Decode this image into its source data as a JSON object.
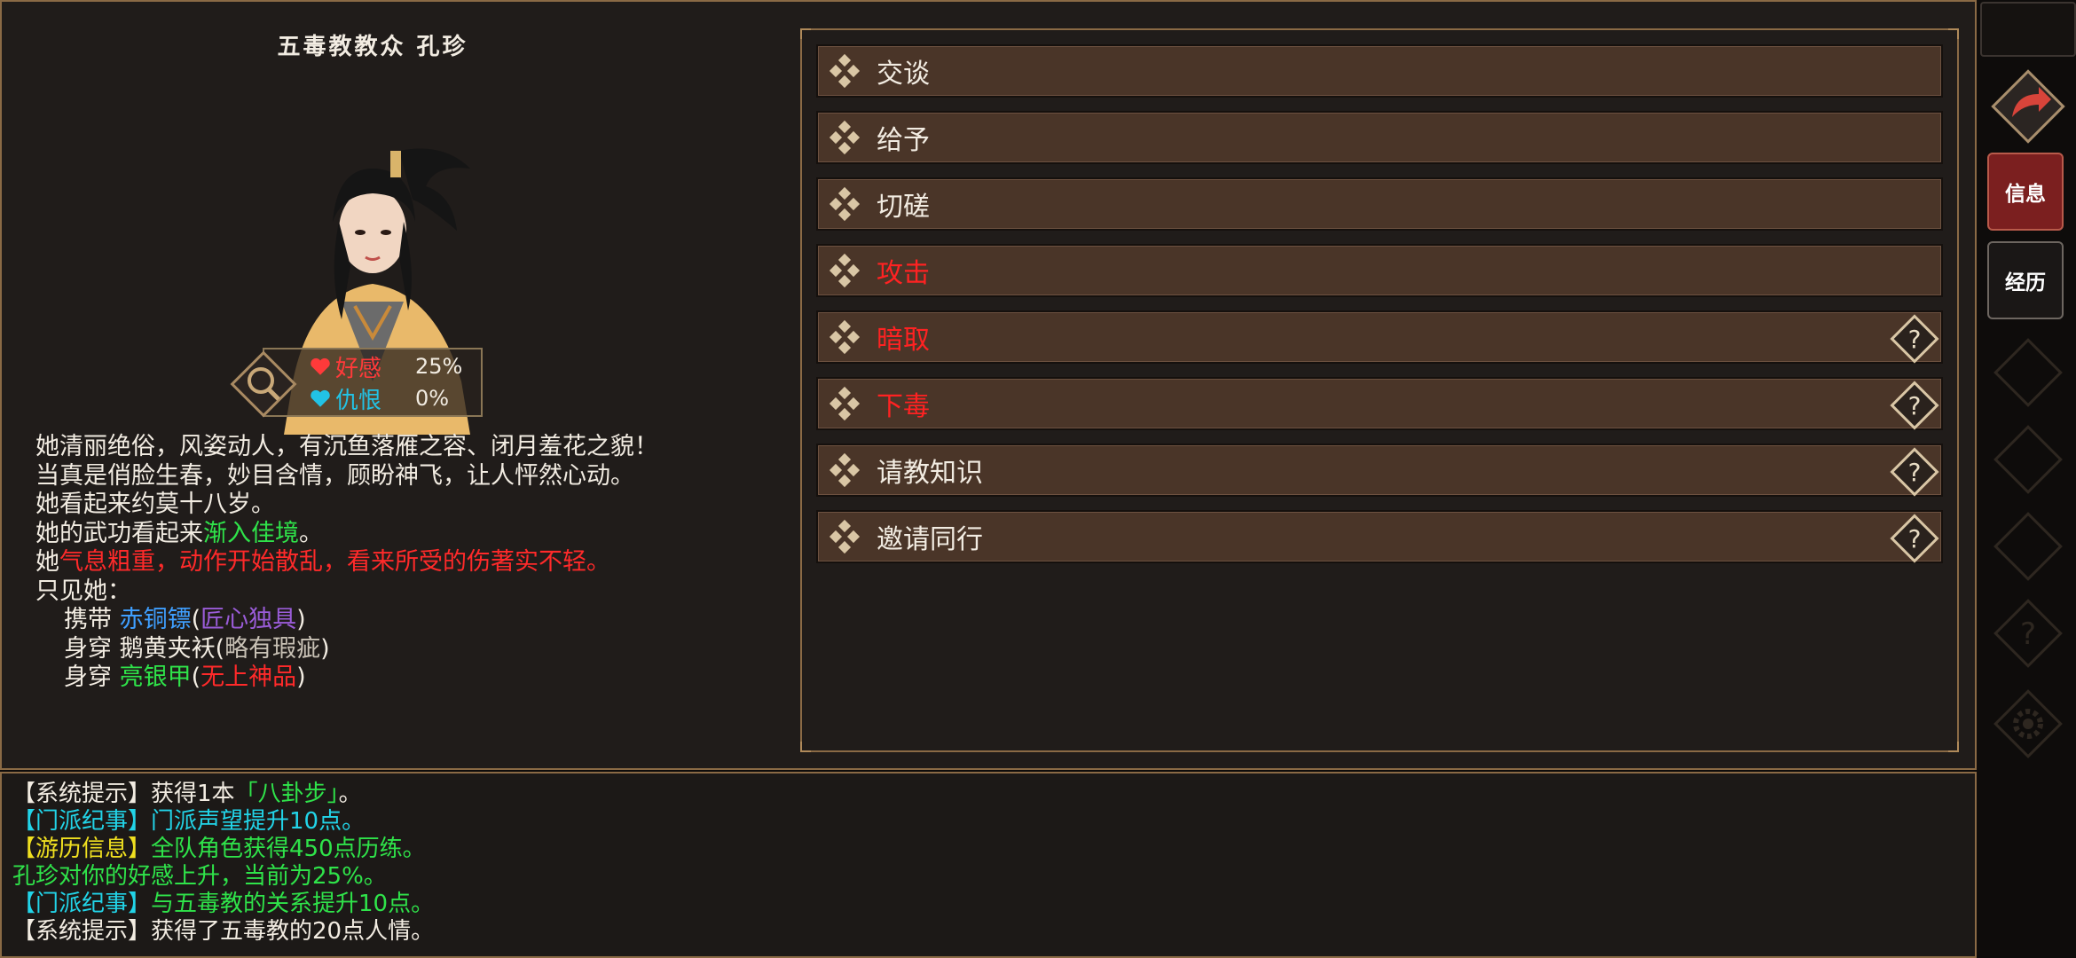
{
  "npc": {
    "title": "五毒教教众  孔珍",
    "favor_label": "好感",
    "favor_value": "25%",
    "hate_label": "仇恨",
    "hate_value": "0%"
  },
  "description": {
    "line1": "她清丽绝俗，风姿动人，有沉鱼落雁之容、闭月羞花之貌！",
    "line2": "当真是俏脸生春，妙目含情，顾盼神飞，让人怦然心动。",
    "line3": "她看起来约莫十八岁。",
    "line4_prefix": "她的武功看起来",
    "line4_level": "渐入佳境",
    "line4_suffix": "。",
    "line5_prefix": "她",
    "line5_status": "气息粗重，动作开始散乱，看来所受的伤著实不轻。",
    "line6": "只见她：",
    "items": [
      {
        "verb": "携带",
        "name": "赤铜镖",
        "open": "(",
        "quality": "匠心独具",
        "close": ")"
      },
      {
        "verb": "身穿",
        "name": "鹅黄夹袄",
        "open": "(",
        "quality": "略有瑕疵",
        "close": ")"
      },
      {
        "verb": "身穿",
        "name": "亮银甲",
        "open": "(",
        "quality": "无上神品",
        "close": ")"
      }
    ]
  },
  "actions": [
    {
      "label": "交谈",
      "color": "#f2ece2"
    },
    {
      "label": "给予",
      "color": "#f2ece2"
    },
    {
      "label": "切磋",
      "color": "#f2ece2"
    },
    {
      "label": "攻击",
      "color": "#ff2222"
    },
    {
      "label": "暗取",
      "color": "#ff2222"
    },
    {
      "label": "下毒",
      "color": "#ff2222"
    },
    {
      "label": "请教知识",
      "color": "#f2ece2"
    },
    {
      "label": "邀请同行",
      "color": "#f2ece2"
    }
  ],
  "sidebar": {
    "tab_info": "信息",
    "tab_experience": "经历"
  },
  "log": {
    "l1_tag": "【系统提示】",
    "l1_text": "获得1本",
    "l1_item": "「八卦步」",
    "l1_end": "。",
    "l2_tag": "【门派纪事】",
    "l2_text": "门派声望提升10点。",
    "l3_tag": "【游历信息】",
    "l3_text": "全队角色获得450点历练。",
    "l4_text": "孔珍对你的好感上升，当前为25%。",
    "l5_tag": "【门派纪事】",
    "l5_text": "与五毒教的关系提升10点。",
    "l6_tag": "【系统提示】",
    "l6_text": "获得了五毒教的20点人情。"
  },
  "colors": {
    "frame_gold": "#8a6a45",
    "action_bg": "#4a3528",
    "danger_red": "#ff2222",
    "success_green": "#2fe34a",
    "info_cyan": "#22d4e8",
    "tab_active": "#7b1f1f"
  },
  "icons": [
    "magnifier-icon",
    "heart-icon",
    "diamond-bullet-icon",
    "question-icon",
    "back-arrow-icon",
    "gear-icon"
  ]
}
